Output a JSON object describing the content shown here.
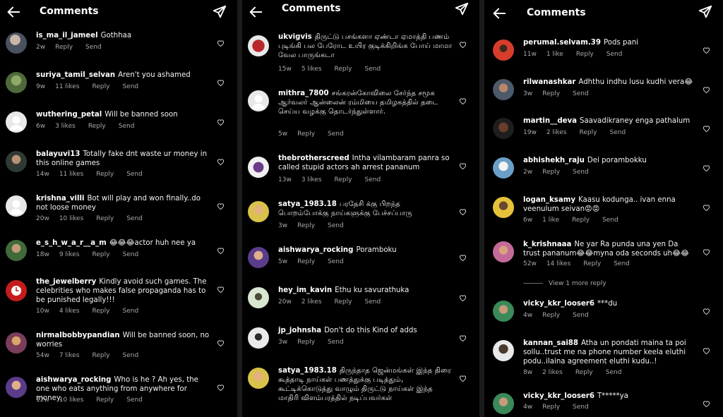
{
  "panels": [
    {
      "title": "Comments",
      "comments": [
        {
          "user": "is_ma_il_jameel",
          "text": "Gothhaa",
          "time": "2w",
          "likes": "",
          "reply": "Reply",
          "send": "Send"
        },
        {
          "user": "suriya_tamil_selvan",
          "text": "Aren't you ashamed",
          "time": "9w",
          "likes": "11 likes",
          "reply": "Reply",
          "send": "Send"
        },
        {
          "user": "wuthering_petal",
          "text": "Will be banned soon",
          "time": "6w",
          "likes": "3 likes",
          "reply": "Reply",
          "send": "Send"
        },
        {
          "user": "balayuvi13",
          "text": "Totally fake dnt waste ur money in this online games",
          "time": "14w",
          "likes": "11 likes",
          "reply": "Reply",
          "send": "Send"
        },
        {
          "user": "krishna_villi",
          "text": "Bot will play and won finally..do not loose money",
          "time": "20w",
          "likes": "10 likes",
          "reply": "Reply",
          "send": "Send"
        },
        {
          "user": "e_s_h_w_a_r__a_m",
          "text": "😂😂😂actor huh nee ya",
          "time": "18w",
          "likes": "9 likes",
          "reply": "Reply",
          "send": "Send"
        },
        {
          "user": "the_jewelberry",
          "text": "Kindly avoid such games. The celebrities who makes false propaganda has to be punished legally!!!",
          "time": "10w",
          "likes": "4 likes",
          "reply": "Reply",
          "send": "Send"
        },
        {
          "user": "nirmalbobbypandian",
          "text": "Will be banned soon, no worries",
          "time": "54w",
          "likes": "7 likes",
          "reply": "Reply",
          "send": "Send"
        },
        {
          "user": "aishwarya_rocking",
          "text": "Who is he ? Ah yes, the one who eats anything from anywhere for money.",
          "time": "12w",
          "likes": "10 likes",
          "reply": "Reply",
          "send": "Send"
        }
      ]
    },
    {
      "title": "Comments",
      "comments": [
        {
          "user": "ukvigvis",
          "text": "திருட்டு பசங்களா ஏண்டா ஏமாத்தி பணம் புடிங்கி பல பேரோட உயிர குடிக்கிறிங்க போய் மாமா வேல பாருங்கடா",
          "time": "15w",
          "likes": "5 likes",
          "reply": "Reply",
          "send": "Send"
        },
        {
          "user": "mithra_7800",
          "text": "சங்கரன்கோவிலை சேர்ந்த சமூக ஆர்வலர் ஆன்லைன் ரம்மியை தமிழகத்தில் தடை செய்ய வழக்கு தொடர்ந்துள்ளார்.",
          "time": "5w",
          "likes": "",
          "reply": "Reply",
          "send": "Send"
        },
        {
          "user": "thebrotherscreed",
          "text": "Intha vilambaram panra so called stupid actors ah arrest pananum",
          "time": "13w",
          "likes": "3 likes",
          "reply": "Reply",
          "send": "Send"
        },
        {
          "user": "satya_1983.18",
          "text": "பரதேசி க்கு பிறந்த பொறம்போக்கு நாய்களுக்கு பேச்சப்பாரு",
          "time": "3w",
          "likes": "",
          "reply": "Reply",
          "send": "Send"
        },
        {
          "user": "aishwarya_rocking",
          "text": "Poramboku",
          "time": "5w",
          "likes": "",
          "reply": "Reply",
          "send": "Send"
        },
        {
          "user": "hey_im_kavin",
          "text": "Ethu ku savurathuka",
          "time": "20w",
          "likes": "2 likes",
          "reply": "Reply",
          "send": "Send"
        },
        {
          "user": "jp_johnsha",
          "text": "Don't do this Kind of adds",
          "time": "3w",
          "likes": "",
          "reply": "Reply",
          "send": "Send"
        },
        {
          "user": "satya_1983.18",
          "text": "திருந்தாத ஜென்மங்கள் இந்த திரை கூத்தாடி நாய்கள் பணத்துக்கு படித்தும், கூட்டிக்கொடுத்து வாழும் திருட்டு நாய்கள் இந்த மாதிரி விளம்பரத்தில் நடிப்பவர்கள்",
          "time": "",
          "likes": "",
          "reply": "",
          "send": ""
        }
      ]
    },
    {
      "title": "Comments",
      "comments": [
        {
          "user": "perumal.selvam.39",
          "text": "Pods pani",
          "time": "11w",
          "likes": "1 like",
          "reply": "Reply",
          "send": "Send"
        },
        {
          "user": "rilwanashkar",
          "text": "Adhthu indhu lusu kudhi vera😂",
          "time": "3w",
          "likes": "",
          "reply": "Reply",
          "send": "Send"
        },
        {
          "user": "martin__deva",
          "text": "Saavadikraney enga pathalum",
          "time": "19w",
          "likes": "2 likes",
          "reply": "Reply",
          "send": "Send"
        },
        {
          "user": "abhishekh_raju",
          "text": "Dei porambokku",
          "time": "2w",
          "likes": "",
          "reply": "Reply",
          "send": "Send"
        },
        {
          "user": "logan_ksamy",
          "text": "Kaasu kodunga.. ivan enna veenulum seivan😡😡",
          "time": "6w",
          "likes": "1 like",
          "reply": "Reply",
          "send": "Send"
        },
        {
          "user": "k_krishnaaa",
          "text": "Ne yar Ra punda una yen Da trust pananum😂😂myna oda seconds uh😂😂",
          "time": "52w",
          "likes": "14 likes",
          "reply": "Reply",
          "send": "Send"
        },
        {
          "user": "vicky_kkr_looser6",
          "text": "***du",
          "time": "4w",
          "likes": "",
          "reply": "Reply",
          "send": "Send"
        },
        {
          "user": "kannan_sai88",
          "text": "Atha un pondati maina ta poi sollu..trust me na phone number keela eluthi podu..ilaina agreement eluthi kudu..!",
          "time": "8w",
          "likes": "2 likes",
          "reply": "Reply",
          "send": "Send"
        },
        {
          "user": "vicky_kkr_looser6",
          "text": "T*****ya",
          "time": "4w",
          "likes": "",
          "reply": "Reply",
          "send": "Send"
        }
      ],
      "view_more": "View 1 more reply"
    }
  ],
  "colors": {
    "background": "#000000",
    "text": "#f2f2f2",
    "meta": "#a8a8a8",
    "divider": "#1b1b1b"
  },
  "icons": {
    "back": "arrow-left-icon",
    "send": "paper-plane-icon",
    "like": "heart-outline-icon"
  }
}
